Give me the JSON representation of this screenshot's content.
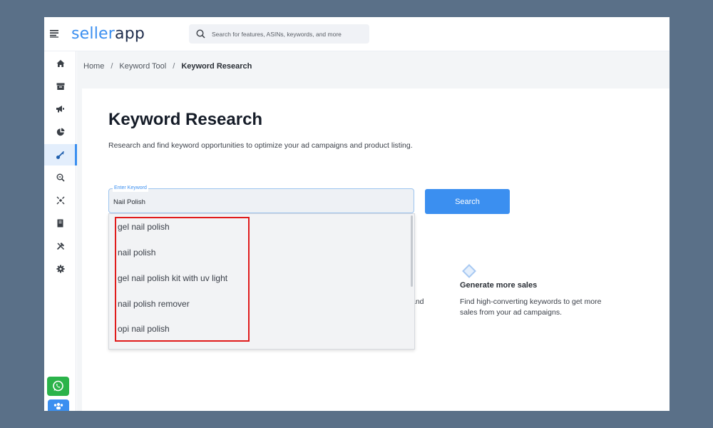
{
  "app": {
    "logo_seller": "seller",
    "logo_app": "app"
  },
  "search": {
    "placeholder": "Search for features, ASINs, keywords, and more"
  },
  "sidebar": {
    "items": [
      {
        "icon": "home-icon"
      },
      {
        "icon": "archive-icon"
      },
      {
        "icon": "megaphone-icon"
      },
      {
        "icon": "pie-chart-icon"
      },
      {
        "icon": "key-icon",
        "active": true
      },
      {
        "icon": "zoom-search-icon"
      },
      {
        "icon": "scan-icon"
      },
      {
        "icon": "notebook-icon"
      },
      {
        "icon": "tools-icon"
      },
      {
        "icon": "gear-icon"
      }
    ],
    "whatsapp_icon": "whatsapp-icon",
    "people_icon": "people-icon"
  },
  "breadcrumb": {
    "items": [
      "Home",
      "Keyword Tool"
    ],
    "separator": "/",
    "current": "Keyword Research"
  },
  "page": {
    "title": "Keyword Research",
    "subtitle": "Research and find keyword opportunities to optimize your ad campaigns and product listing."
  },
  "keyword_field": {
    "legend": "Enter Keyword",
    "value": "Nail Polish"
  },
  "search_button": {
    "label": "Search"
  },
  "suggestions": [
    "gel nail polish",
    "nail polish",
    "gel nail polish kit with uv light",
    "nail polish remover",
    "opi nail polish"
  ],
  "partial_text": "and",
  "feature": {
    "title": "Generate more sales",
    "description": "Find high-converting keywords to get more sales from your ad campaigns."
  },
  "colors": {
    "accent": "#3b8ff0",
    "highlight_border": "#e01b1b",
    "whatsapp": "#2bb34a",
    "frame_background": "#5a7088"
  }
}
